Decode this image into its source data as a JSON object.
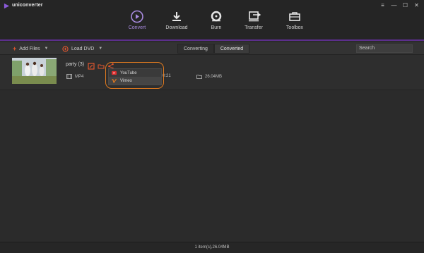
{
  "app": {
    "name": "uniconverter"
  },
  "window_controls": [
    "menu",
    "minimize",
    "maximize",
    "close"
  ],
  "nav": [
    {
      "label": "Convert",
      "icon": "convert-icon",
      "active": true
    },
    {
      "label": "Download",
      "icon": "download-icon",
      "active": false
    },
    {
      "label": "Burn",
      "icon": "burn-icon",
      "active": false
    },
    {
      "label": "Transfer",
      "icon": "transfer-icon",
      "active": false
    },
    {
      "label": "Toolbox",
      "icon": "toolbox-icon",
      "active": false
    }
  ],
  "toolbar": {
    "add_files_label": "Add Files",
    "load_dvd_label": "Load DVD",
    "tabs": [
      {
        "label": "Converting",
        "active": false
      },
      {
        "label": "Converted",
        "active": true
      }
    ],
    "search_placeholder": "Search"
  },
  "file": {
    "name": "party (3)",
    "format": "MP4",
    "duration": "0:21",
    "size": "26.04MB"
  },
  "share_menu": {
    "items": [
      {
        "label": "YouTube",
        "icon": "youtube-icon"
      },
      {
        "label": "Vimeo",
        "icon": "vimeo-icon"
      }
    ]
  },
  "status": {
    "text": "1 item(s),26.04MB"
  },
  "colors": {
    "accent": "#7b4fc9",
    "highlight": "#e07a1f",
    "brand": "#e0562f"
  }
}
